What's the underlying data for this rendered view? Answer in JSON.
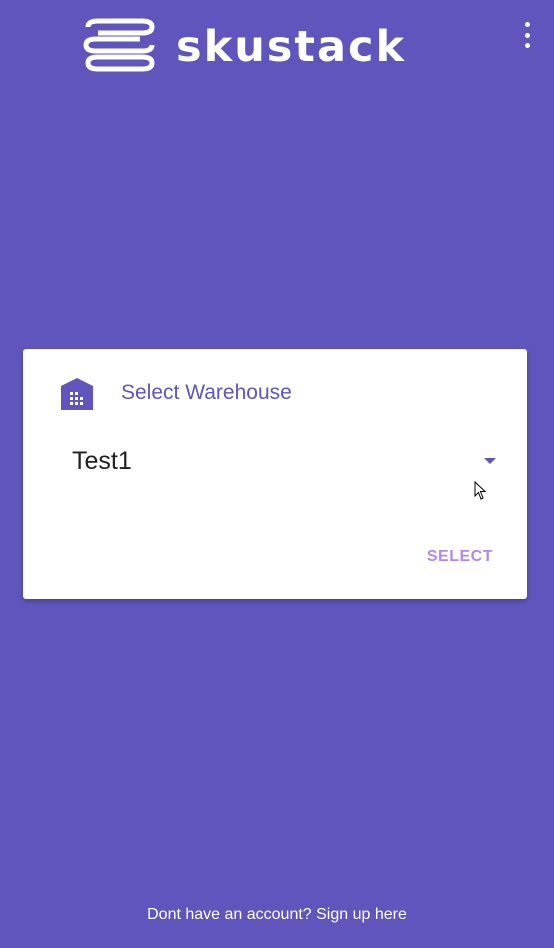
{
  "header": {
    "logo_text": "skustack",
    "menu_icon": "more-vert-icon"
  },
  "card": {
    "icon": "warehouse-icon",
    "title": "Select Warehouse",
    "dropdown": {
      "selected_value": "Test1",
      "caret_icon": "arrow-drop-down-icon"
    },
    "select_label": "SELECT"
  },
  "footer": {
    "signup_text": "Dont have an account? Sign up here"
  },
  "colors": {
    "background": "#5f55bc",
    "card_background": "#ffffff",
    "accent": "#b388e8",
    "title": "#5f55bc"
  }
}
